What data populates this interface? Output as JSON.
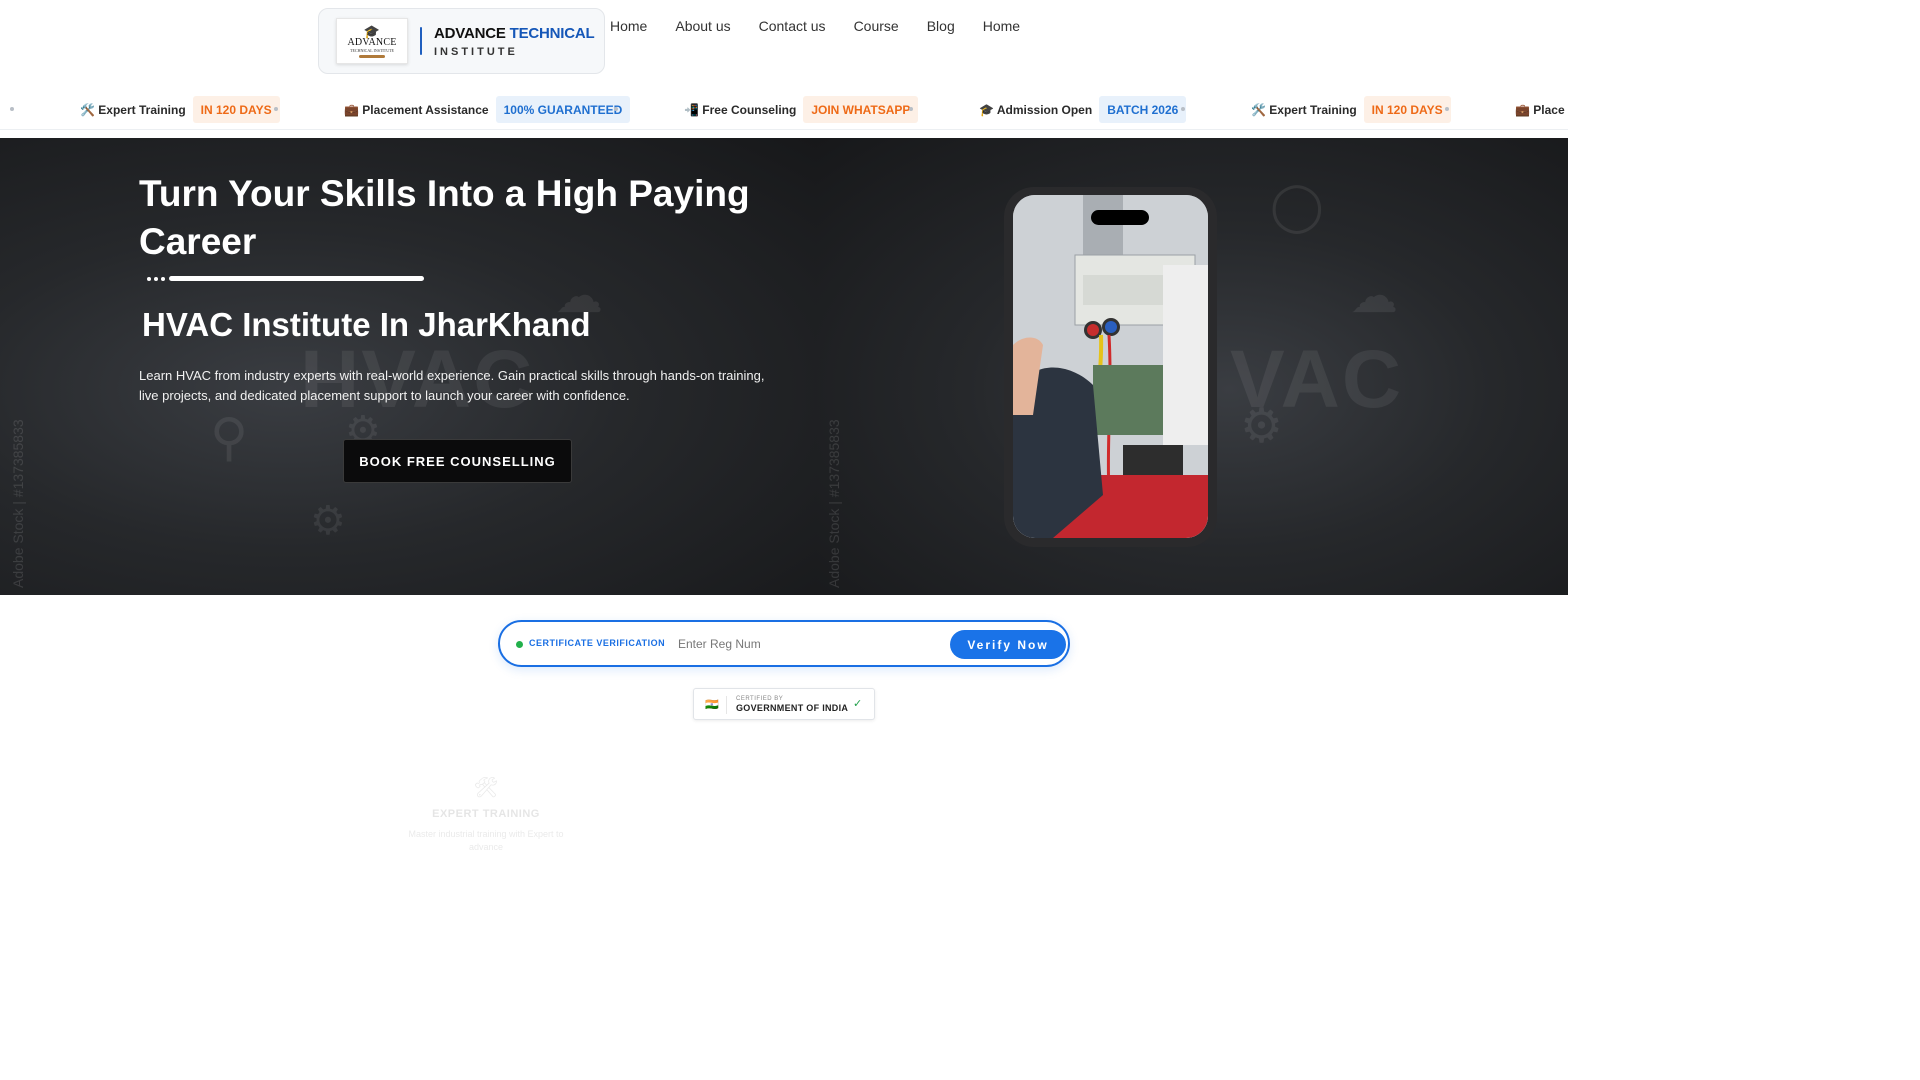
{
  "logo": {
    "image_word": "ADVANCE",
    "image_sub": "TECHNICAL INSTITUTE",
    "brand_part1": "ADVANCE",
    "brand_part2": "TECHNICAL",
    "brand_line2": "INSTITUTE"
  },
  "nav": {
    "items": [
      "Home",
      "About us",
      "Contact us",
      "Course",
      "Blog",
      "Home"
    ]
  },
  "ticker": {
    "items": [
      {
        "icon": "🛠️",
        "label": "Expert Training",
        "badge": "IN 120 DAYS",
        "badge_color": "orange"
      },
      {
        "icon": "💼",
        "label": "Placement Assistance",
        "badge": "100% GUARANTEED",
        "badge_color": "blue"
      },
      {
        "icon": "📲",
        "label": "Free Counseling",
        "badge": "JOIN WHATSAPP",
        "badge_color": "orange"
      },
      {
        "icon": "🎓",
        "label": "Admission Open",
        "badge": "BATCH 2026",
        "badge_color": "blue"
      },
      {
        "icon": "🛠️",
        "label": "Expert Training",
        "badge": "IN 120 DAYS",
        "badge_color": "orange"
      },
      {
        "icon": "💼",
        "label": "Place",
        "badge": "",
        "badge_color": "blue"
      }
    ]
  },
  "hero": {
    "title": "Turn Your Skills Into a High Paying Career",
    "subtitle": "HVAC Institute In JharKhand",
    "description": "Learn HVAC from industry experts with real-world experience. Gain practical skills through hands-on training, live projects, and dedicated placement support to launch your career with confidence.",
    "cta_label": "BOOK FREE COUNSELLING",
    "watermark_left": "HVAC",
    "watermark_right": "VAC",
    "stock_mark": "Adobe Stock | #137385833"
  },
  "verification": {
    "label": "CERTIFICATE VERIFICATION",
    "placeholder": "Enter Reg Num",
    "value": "",
    "button": "Verify Now"
  },
  "certified": {
    "flag": "🇮🇳",
    "small": "CERTIFIED BY",
    "big": "GOVERNMENT OF INDIA",
    "check": "✓"
  },
  "feature": {
    "icon": "🛠",
    "title": "EXPERT TRAINING",
    "description": "Master industrial training with Expert to advance"
  },
  "colors": {
    "accent_blue": "#1a73e8",
    "badge_orange": "#ee6a17",
    "hero_bg": "#1c1d1f"
  }
}
